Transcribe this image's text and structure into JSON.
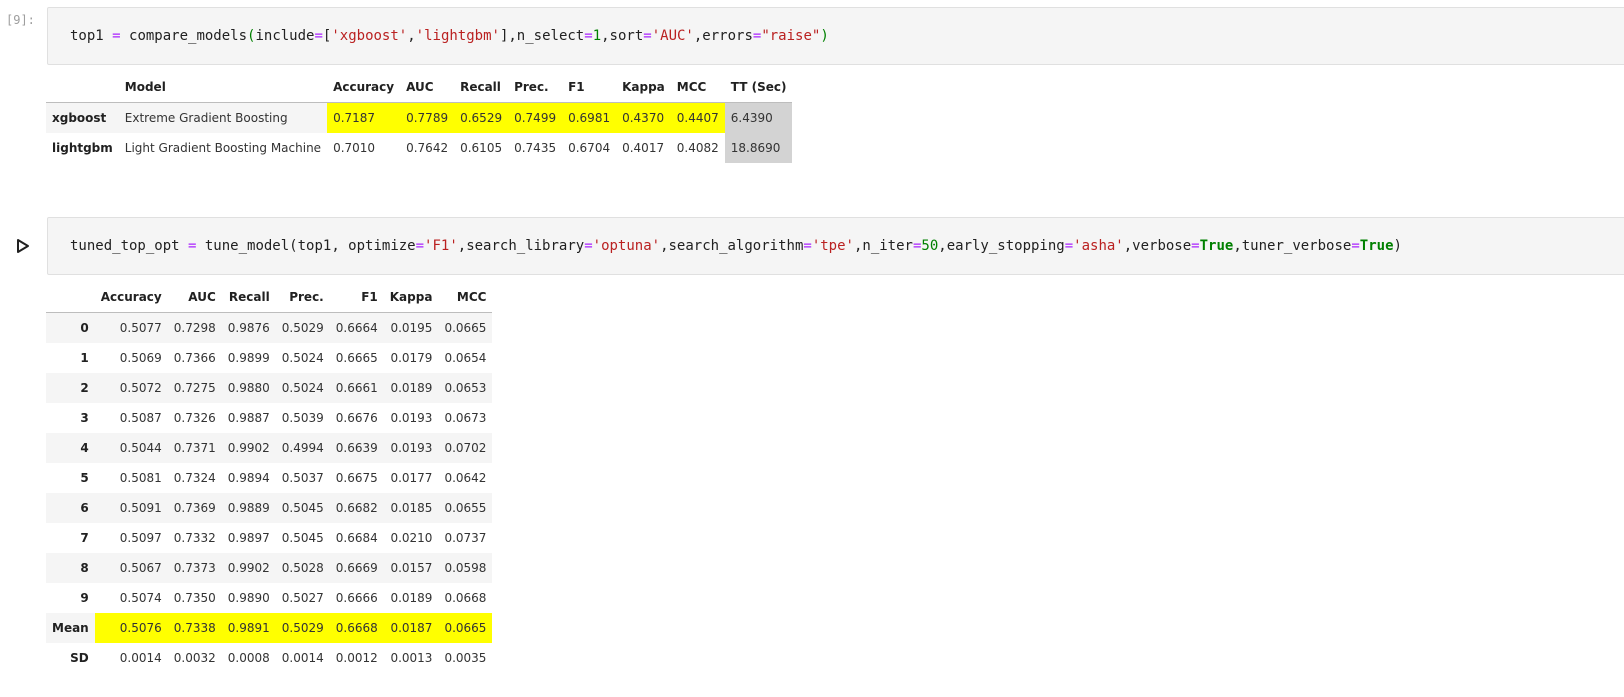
{
  "cell1": {
    "prompt": "[9]:",
    "code": "top1 = compare_models(include=['xgboost','lightgbm'],n_select=1,sort='AUC',errors=\"raise\")"
  },
  "table1": {
    "columns": [
      "",
      "Model",
      "Accuracy",
      "AUC",
      "Recall",
      "Prec.",
      "F1",
      "Kappa",
      "MCC",
      "TT (Sec)"
    ],
    "rows": [
      {
        "index": "xgboost",
        "cells": [
          "Extreme Gradient Boosting",
          "0.7187",
          "0.7789",
          "0.6529",
          "0.7499",
          "0.6981",
          "0.4370",
          "0.4407",
          "6.4390"
        ]
      },
      {
        "index": "lightgbm",
        "cells": [
          "Light Gradient Boosting Machine",
          "0.7010",
          "0.7642",
          "0.6105",
          "0.7435",
          "0.6704",
          "0.4017",
          "0.4082",
          "18.8690"
        ]
      }
    ]
  },
  "cell2": {
    "code": "tuned_top_opt = tune_model(top1, optimize='F1',search_library='optuna',search_algorithm='tpe',n_iter=50,early_stopping='asha',verbose=True,tuner_verbose=True)"
  },
  "table2": {
    "columns": [
      "",
      "Accuracy",
      "AUC",
      "Recall",
      "Prec.",
      "F1",
      "Kappa",
      "MCC"
    ],
    "rows": [
      {
        "index": "0",
        "cells": [
          "0.5077",
          "0.7298",
          "0.9876",
          "0.5029",
          "0.6664",
          "0.0195",
          "0.0665"
        ]
      },
      {
        "index": "1",
        "cells": [
          "0.5069",
          "0.7366",
          "0.9899",
          "0.5024",
          "0.6665",
          "0.0179",
          "0.0654"
        ]
      },
      {
        "index": "2",
        "cells": [
          "0.5072",
          "0.7275",
          "0.9880",
          "0.5024",
          "0.6661",
          "0.0189",
          "0.0653"
        ]
      },
      {
        "index": "3",
        "cells": [
          "0.5087",
          "0.7326",
          "0.9887",
          "0.5039",
          "0.6676",
          "0.0193",
          "0.0673"
        ]
      },
      {
        "index": "4",
        "cells": [
          "0.5044",
          "0.7371",
          "0.9902",
          "0.4994",
          "0.6639",
          "0.0193",
          "0.0702"
        ]
      },
      {
        "index": "5",
        "cells": [
          "0.5081",
          "0.7324",
          "0.9894",
          "0.5037",
          "0.6675",
          "0.0177",
          "0.0642"
        ]
      },
      {
        "index": "6",
        "cells": [
          "0.5091",
          "0.7369",
          "0.9889",
          "0.5045",
          "0.6682",
          "0.0185",
          "0.0655"
        ]
      },
      {
        "index": "7",
        "cells": [
          "0.5097",
          "0.7332",
          "0.9897",
          "0.5045",
          "0.6684",
          "0.0210",
          "0.0737"
        ]
      },
      {
        "index": "8",
        "cells": [
          "0.5067",
          "0.7373",
          "0.9902",
          "0.5028",
          "0.6669",
          "0.0157",
          "0.0598"
        ]
      },
      {
        "index": "9",
        "cells": [
          "0.5074",
          "0.7350",
          "0.9890",
          "0.5027",
          "0.6666",
          "0.0189",
          "0.0668"
        ]
      },
      {
        "index": "Mean",
        "cells": [
          "0.5076",
          "0.7338",
          "0.9891",
          "0.5029",
          "0.6668",
          "0.0187",
          "0.0665"
        ]
      },
      {
        "index": "SD",
        "cells": [
          "0.0014",
          "0.0032",
          "0.0008",
          "0.0014",
          "0.0012",
          "0.0013",
          "0.0035"
        ]
      }
    ]
  },
  "colors": {
    "highlight": "#ffff00",
    "gray": "#d3d3d3"
  },
  "icons": {
    "run": "play-triangle-icon"
  }
}
